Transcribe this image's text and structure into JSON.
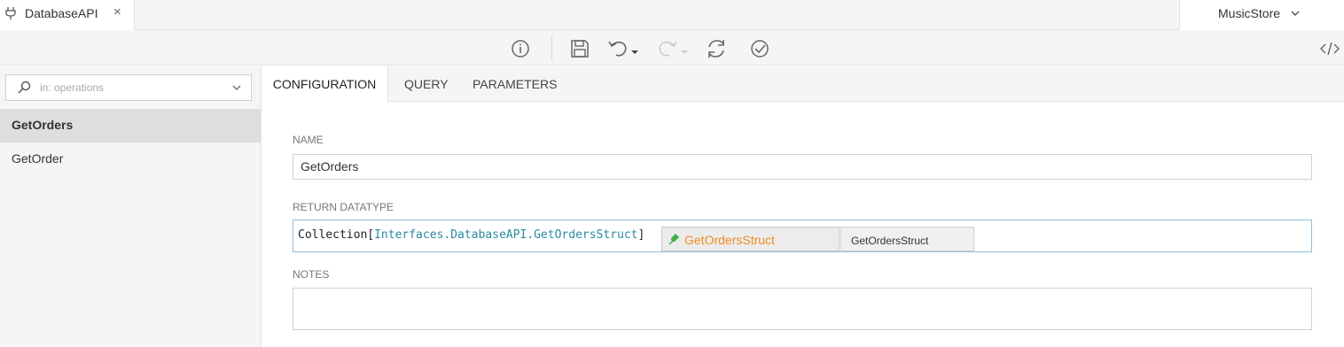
{
  "tabbar": {
    "tab_title": "DatabaseAPI",
    "tab_icon": "plug-icon",
    "close_glyph": "×",
    "project_name": "MusicStore"
  },
  "toolbar": {
    "buttons": [
      "info-icon",
      "save-icon",
      "undo-icon",
      "redo-icon",
      "refresh-icon",
      "validate-icon",
      "code-view-icon"
    ]
  },
  "sidebar": {
    "search_placeholder": "in: operations",
    "operations": [
      {
        "label": "GetOrders",
        "selected": true
      },
      {
        "label": "GetOrder",
        "selected": false
      }
    ]
  },
  "tabs": [
    {
      "label": "CONFIGURATION",
      "active": true
    },
    {
      "label": "QUERY",
      "active": false
    },
    {
      "label": "PARAMETERS",
      "active": false
    }
  ],
  "form": {
    "name_label": "NAME",
    "name_value": "GetOrders",
    "return_label": "RETURN DATATYPE",
    "return_prefix": "Collection[",
    "return_path": "Interfaces.DatabaseAPI.GetOrdersStruct",
    "return_suffix": "]",
    "notes_label": "NOTES",
    "notes_value": ""
  },
  "autocomplete": {
    "suggestion_primary": "GetOrdersStruct",
    "suggestion_secondary": "GetOrdersStruct",
    "highlight_color": "#f08a24",
    "leaf_color": "#3cb04a"
  },
  "colors": {
    "accent_teal": "#2a8aa0",
    "border_focus": "#8ec0d6"
  }
}
